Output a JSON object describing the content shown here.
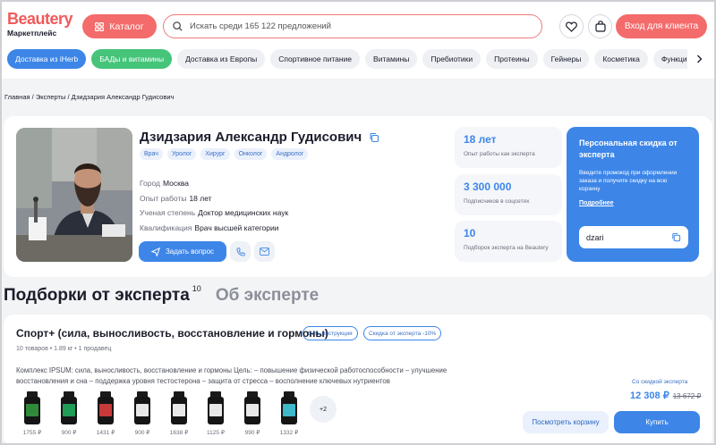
{
  "header": {
    "logo_name": "Beautery",
    "logo_sub": "Маркетплейс",
    "catalog_label": "Каталог",
    "search_placeholder": "Искать среди 165 122 предложений",
    "login_label": "Вход для клиента"
  },
  "categories": [
    {
      "label": "Доставка из iHerb",
      "style": "blue"
    },
    {
      "label": "БАДы и витамины",
      "style": "green"
    },
    {
      "label": "Доставка из Европы",
      "style": "plain"
    },
    {
      "label": "Спортивное питание",
      "style": "plain"
    },
    {
      "label": "Витамины",
      "style": "plain"
    },
    {
      "label": "Пребиотики",
      "style": "plain"
    },
    {
      "label": "Протеины",
      "style": "plain"
    },
    {
      "label": "Гейнеры",
      "style": "plain"
    },
    {
      "label": "Косметика",
      "style": "plain"
    },
    {
      "label": "Функциональное пи",
      "style": "plain"
    }
  ],
  "breadcrumb": {
    "home": "Главная",
    "experts": "Эксперты",
    "current": "Дзидзария Александр Гудисович"
  },
  "expert": {
    "name": "Дзидзария Александр Гудисович",
    "tags": [
      "Врач",
      "Уролог",
      "Хирург",
      "Онколог",
      "Андролог"
    ],
    "details": [
      {
        "key": "Город",
        "value": "Москва"
      },
      {
        "key": "Опыт работы",
        "value": "18 лет"
      },
      {
        "key": "Ученая степень",
        "value": "Доктор медицинских наук"
      },
      {
        "key": "Квалификация",
        "value": "Врач высшей категории"
      }
    ],
    "ask_label": "Задать вопрос"
  },
  "stats": [
    {
      "number": "18 лет",
      "label": "Опыт работы как эксперта"
    },
    {
      "number": "3 300 000",
      "label": "Подписчиков в соцсетях"
    },
    {
      "number": "10",
      "label": "Подборок эксперта на Beautery"
    }
  ],
  "promo": {
    "title": "Персональная скидка от эксперта",
    "desc": "Введите промокод при оформлении заказа и получите скидку на всю корзину",
    "more": "Подробнее",
    "code": "dzari"
  },
  "tabs": {
    "collections": "Подборки от эксперта",
    "collections_count": "10",
    "about": "Об эксперте"
  },
  "collection": {
    "title": "Спорт+ (сила, выносливость, восстановление и гормоны)",
    "badge1": "Есть инструкция",
    "badge2": "Скидка от эксперта -10%",
    "meta": "10 товаров  •  1.89 кг  •  1 продавец",
    "desc": "Комплекс IPSUM: сила, выносливость, восстановление и гормоны Цель: – повышение физической работоспособности – улучшение восстановления и сна – поддержка уровня тестостерона – защита от стресса – восполнение ключевых нутриентов",
    "products": [
      {
        "price": "1755 ₽",
        "color": "#2f8a3a"
      },
      {
        "price": "900 ₽",
        "color": "#1f9c55"
      },
      {
        "price": "1431 ₽",
        "color": "#c83a3a"
      },
      {
        "price": "900 ₽",
        "color": "#e8e8e8"
      },
      {
        "price": "1638 ₽",
        "color": "#e8e8e8"
      },
      {
        "price": "1125 ₽",
        "color": "#e8e8e8"
      },
      {
        "price": "990 ₽",
        "color": "#e8e8e8"
      },
      {
        "price": "1332 ₽",
        "color": "#3fb8c9"
      }
    ],
    "more_count": "+2",
    "discount_label": "Со скидкой эксперта",
    "price": "12 308 ₽",
    "old_price": "13 672 ₽",
    "cart_label": "Посмотреть корзину",
    "buy_label": "Купить"
  }
}
